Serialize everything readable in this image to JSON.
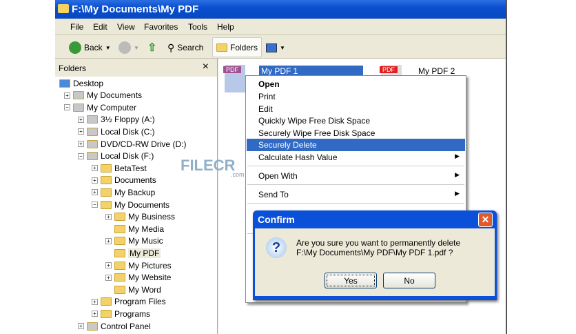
{
  "window": {
    "title": "F:\\My Documents\\My PDF"
  },
  "menubar": [
    "File",
    "Edit",
    "View",
    "Favorites",
    "Tools",
    "Help"
  ],
  "toolbar": {
    "back": "Back",
    "search": "Search",
    "folders": "Folders"
  },
  "folders_pane": {
    "title": "Folders",
    "close": "×",
    "tree": [
      {
        "label": "Desktop",
        "level": 0,
        "exp": ""
      },
      {
        "label": "My Documents",
        "level": 1,
        "exp": "+"
      },
      {
        "label": "My Computer",
        "level": 1,
        "exp": "−"
      },
      {
        "label": "3½ Floppy (A:)",
        "level": 2,
        "exp": "+"
      },
      {
        "label": "Local Disk (C:)",
        "level": 2,
        "exp": "+"
      },
      {
        "label": "DVD/CD-RW Drive (D:)",
        "level": 2,
        "exp": "+"
      },
      {
        "label": "Local Disk (F:)",
        "level": 2,
        "exp": "−"
      },
      {
        "label": "BetaTest",
        "level": 3,
        "exp": "+"
      },
      {
        "label": "Documents",
        "level": 3,
        "exp": "+"
      },
      {
        "label": "My Backup",
        "level": 3,
        "exp": "+"
      },
      {
        "label": "My Documents",
        "level": 3,
        "exp": "−"
      },
      {
        "label": "My Business",
        "level": 4,
        "exp": "+"
      },
      {
        "label": "My Media",
        "level": 4,
        "exp": ""
      },
      {
        "label": "My Music",
        "level": 4,
        "exp": "+"
      },
      {
        "label": "My PDF",
        "level": 4,
        "exp": "",
        "selected": true
      },
      {
        "label": "My Pictures",
        "level": 4,
        "exp": "+"
      },
      {
        "label": "My Website",
        "level": 4,
        "exp": "+"
      },
      {
        "label": "My Word",
        "level": 4,
        "exp": ""
      },
      {
        "label": "Program Files",
        "level": 3,
        "exp": "+"
      },
      {
        "label": "Programs",
        "level": 3,
        "exp": "+"
      },
      {
        "label": "Control Panel",
        "level": 2,
        "exp": "+"
      }
    ]
  },
  "files": [
    {
      "name": "My PDF 1",
      "badge": "PDF"
    },
    {
      "name": "My PDF 2",
      "badge": "PDF"
    }
  ],
  "context_menu": {
    "items": [
      {
        "label": "Open",
        "bold": true
      },
      {
        "label": "Print"
      },
      {
        "label": "Edit"
      },
      {
        "label": "Quickly Wipe Free Disk Space"
      },
      {
        "label": "Securely Wipe Free Disk Space"
      },
      {
        "label": "Securely Delete",
        "selected": true
      },
      {
        "label": "Calculate Hash Value",
        "submenu": true
      },
      {
        "label": "Open With",
        "submenu": true
      },
      {
        "label": "Send To",
        "submenu": true
      }
    ]
  },
  "dialog": {
    "title": "Confirm",
    "line1": "Are you sure you want to permanently delete",
    "line2": "F:\\My Documents\\My PDF\\My PDF 1.pdf ?",
    "yes": "Yes",
    "no": "No"
  },
  "watermark": {
    "text": "FILECR",
    "sub": ".com"
  }
}
